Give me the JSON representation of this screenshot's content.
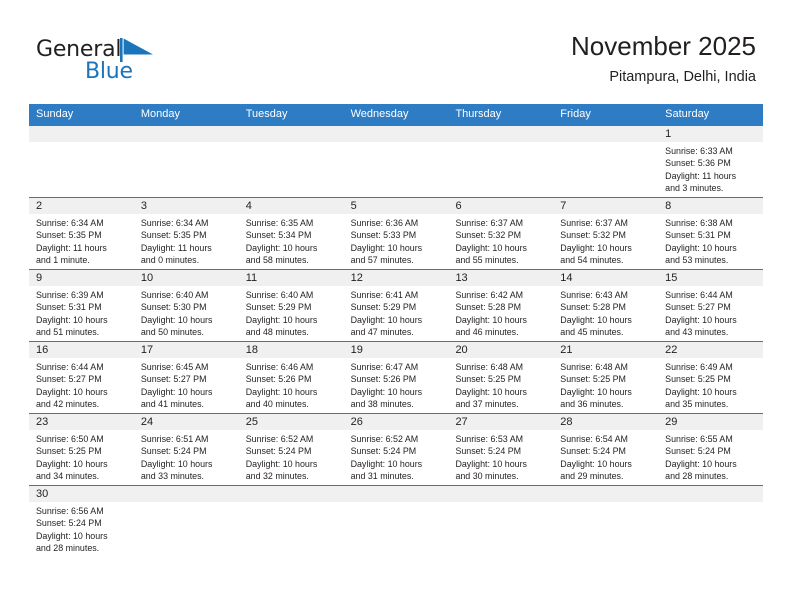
{
  "brand": {
    "name_top": "General",
    "name_bottom": "Blue",
    "accent_color": "#1b75bb",
    "flag_icon": "blue-flag-triangle-icon"
  },
  "header": {
    "title": "November 2025",
    "subtitle": "Pitampura, Delhi, India"
  },
  "colors": {
    "header_blue": "#2e7cc3",
    "day_band_gray": "#f0f0f0",
    "text": "#231f20"
  },
  "calendar": {
    "weekdays": [
      "Sunday",
      "Monday",
      "Tuesday",
      "Wednesday",
      "Thursday",
      "Friday",
      "Saturday"
    ],
    "weeks": [
      [
        {
          "day": "",
          "lines": []
        },
        {
          "day": "",
          "lines": []
        },
        {
          "day": "",
          "lines": []
        },
        {
          "day": "",
          "lines": []
        },
        {
          "day": "",
          "lines": []
        },
        {
          "day": "",
          "lines": []
        },
        {
          "day": "1",
          "lines": [
            "Sunrise: 6:33 AM",
            "Sunset: 5:36 PM",
            "Daylight: 11 hours",
            "and 3 minutes."
          ]
        }
      ],
      [
        {
          "day": "2",
          "lines": [
            "Sunrise: 6:34 AM",
            "Sunset: 5:35 PM",
            "Daylight: 11 hours",
            "and 1 minute."
          ]
        },
        {
          "day": "3",
          "lines": [
            "Sunrise: 6:34 AM",
            "Sunset: 5:35 PM",
            "Daylight: 11 hours",
            "and 0 minutes."
          ]
        },
        {
          "day": "4",
          "lines": [
            "Sunrise: 6:35 AM",
            "Sunset: 5:34 PM",
            "Daylight: 10 hours",
            "and 58 minutes."
          ]
        },
        {
          "day": "5",
          "lines": [
            "Sunrise: 6:36 AM",
            "Sunset: 5:33 PM",
            "Daylight: 10 hours",
            "and 57 minutes."
          ]
        },
        {
          "day": "6",
          "lines": [
            "Sunrise: 6:37 AM",
            "Sunset: 5:32 PM",
            "Daylight: 10 hours",
            "and 55 minutes."
          ]
        },
        {
          "day": "7",
          "lines": [
            "Sunrise: 6:37 AM",
            "Sunset: 5:32 PM",
            "Daylight: 10 hours",
            "and 54 minutes."
          ]
        },
        {
          "day": "8",
          "lines": [
            "Sunrise: 6:38 AM",
            "Sunset: 5:31 PM",
            "Daylight: 10 hours",
            "and 53 minutes."
          ]
        }
      ],
      [
        {
          "day": "9",
          "lines": [
            "Sunrise: 6:39 AM",
            "Sunset: 5:31 PM",
            "Daylight: 10 hours",
            "and 51 minutes."
          ]
        },
        {
          "day": "10",
          "lines": [
            "Sunrise: 6:40 AM",
            "Sunset: 5:30 PM",
            "Daylight: 10 hours",
            "and 50 minutes."
          ]
        },
        {
          "day": "11",
          "lines": [
            "Sunrise: 6:40 AM",
            "Sunset: 5:29 PM",
            "Daylight: 10 hours",
            "and 48 minutes."
          ]
        },
        {
          "day": "12",
          "lines": [
            "Sunrise: 6:41 AM",
            "Sunset: 5:29 PM",
            "Daylight: 10 hours",
            "and 47 minutes."
          ]
        },
        {
          "day": "13",
          "lines": [
            "Sunrise: 6:42 AM",
            "Sunset: 5:28 PM",
            "Daylight: 10 hours",
            "and 46 minutes."
          ]
        },
        {
          "day": "14",
          "lines": [
            "Sunrise: 6:43 AM",
            "Sunset: 5:28 PM",
            "Daylight: 10 hours",
            "and 45 minutes."
          ]
        },
        {
          "day": "15",
          "lines": [
            "Sunrise: 6:44 AM",
            "Sunset: 5:27 PM",
            "Daylight: 10 hours",
            "and 43 minutes."
          ]
        }
      ],
      [
        {
          "day": "16",
          "lines": [
            "Sunrise: 6:44 AM",
            "Sunset: 5:27 PM",
            "Daylight: 10 hours",
            "and 42 minutes."
          ]
        },
        {
          "day": "17",
          "lines": [
            "Sunrise: 6:45 AM",
            "Sunset: 5:27 PM",
            "Daylight: 10 hours",
            "and 41 minutes."
          ]
        },
        {
          "day": "18",
          "lines": [
            "Sunrise: 6:46 AM",
            "Sunset: 5:26 PM",
            "Daylight: 10 hours",
            "and 40 minutes."
          ]
        },
        {
          "day": "19",
          "lines": [
            "Sunrise: 6:47 AM",
            "Sunset: 5:26 PM",
            "Daylight: 10 hours",
            "and 38 minutes."
          ]
        },
        {
          "day": "20",
          "lines": [
            "Sunrise: 6:48 AM",
            "Sunset: 5:25 PM",
            "Daylight: 10 hours",
            "and 37 minutes."
          ]
        },
        {
          "day": "21",
          "lines": [
            "Sunrise: 6:48 AM",
            "Sunset: 5:25 PM",
            "Daylight: 10 hours",
            "and 36 minutes."
          ]
        },
        {
          "day": "22",
          "lines": [
            "Sunrise: 6:49 AM",
            "Sunset: 5:25 PM",
            "Daylight: 10 hours",
            "and 35 minutes."
          ]
        }
      ],
      [
        {
          "day": "23",
          "lines": [
            "Sunrise: 6:50 AM",
            "Sunset: 5:25 PM",
            "Daylight: 10 hours",
            "and 34 minutes."
          ]
        },
        {
          "day": "24",
          "lines": [
            "Sunrise: 6:51 AM",
            "Sunset: 5:24 PM",
            "Daylight: 10 hours",
            "and 33 minutes."
          ]
        },
        {
          "day": "25",
          "lines": [
            "Sunrise: 6:52 AM",
            "Sunset: 5:24 PM",
            "Daylight: 10 hours",
            "and 32 minutes."
          ]
        },
        {
          "day": "26",
          "lines": [
            "Sunrise: 6:52 AM",
            "Sunset: 5:24 PM",
            "Daylight: 10 hours",
            "and 31 minutes."
          ]
        },
        {
          "day": "27",
          "lines": [
            "Sunrise: 6:53 AM",
            "Sunset: 5:24 PM",
            "Daylight: 10 hours",
            "and 30 minutes."
          ]
        },
        {
          "day": "28",
          "lines": [
            "Sunrise: 6:54 AM",
            "Sunset: 5:24 PM",
            "Daylight: 10 hours",
            "and 29 minutes."
          ]
        },
        {
          "day": "29",
          "lines": [
            "Sunrise: 6:55 AM",
            "Sunset: 5:24 PM",
            "Daylight: 10 hours",
            "and 28 minutes."
          ]
        }
      ],
      [
        {
          "day": "30",
          "lines": [
            "Sunrise: 6:56 AM",
            "Sunset: 5:24 PM",
            "Daylight: 10 hours",
            "and 28 minutes."
          ]
        },
        {
          "day": "",
          "lines": []
        },
        {
          "day": "",
          "lines": []
        },
        {
          "day": "",
          "lines": []
        },
        {
          "day": "",
          "lines": []
        },
        {
          "day": "",
          "lines": []
        },
        {
          "day": "",
          "lines": []
        }
      ]
    ]
  }
}
